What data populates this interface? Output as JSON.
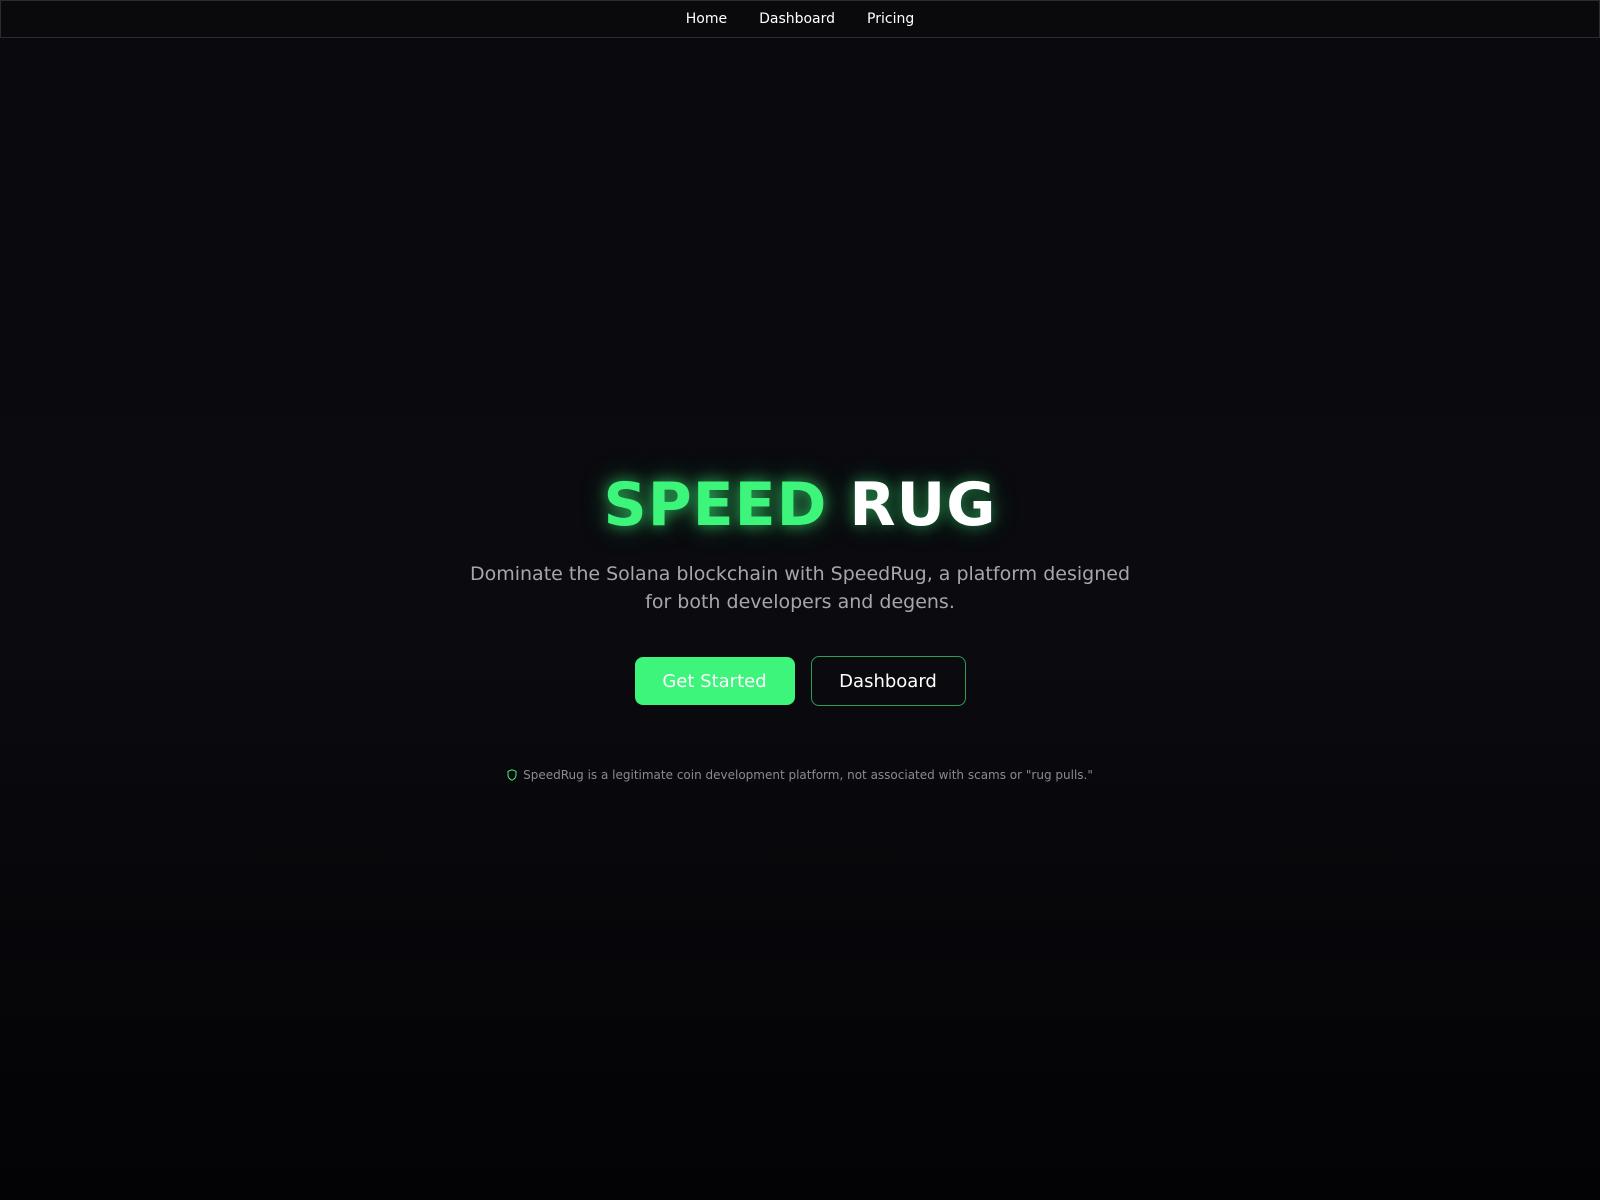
{
  "nav": {
    "items": [
      {
        "label": "Home"
      },
      {
        "label": "Dashboard"
      },
      {
        "label": "Pricing"
      }
    ]
  },
  "hero": {
    "title_part1": "SPEED",
    "title_part2": "RUG",
    "subtitle": "Dominate the Solana blockchain with SpeedRug, a platform designed for both developers and degens.",
    "primary_button": "Get Started",
    "secondary_button": "Dashboard",
    "disclaimer": "SpeedRug is a legitimate coin development platform, not associated with scams or \"rug pulls.\""
  },
  "colors": {
    "accent": "#3cf57a",
    "background": "#0a0a0e",
    "subtitle_text": "#a6a6ad"
  },
  "icons": {
    "disclaimer_icon": "shield-icon"
  }
}
